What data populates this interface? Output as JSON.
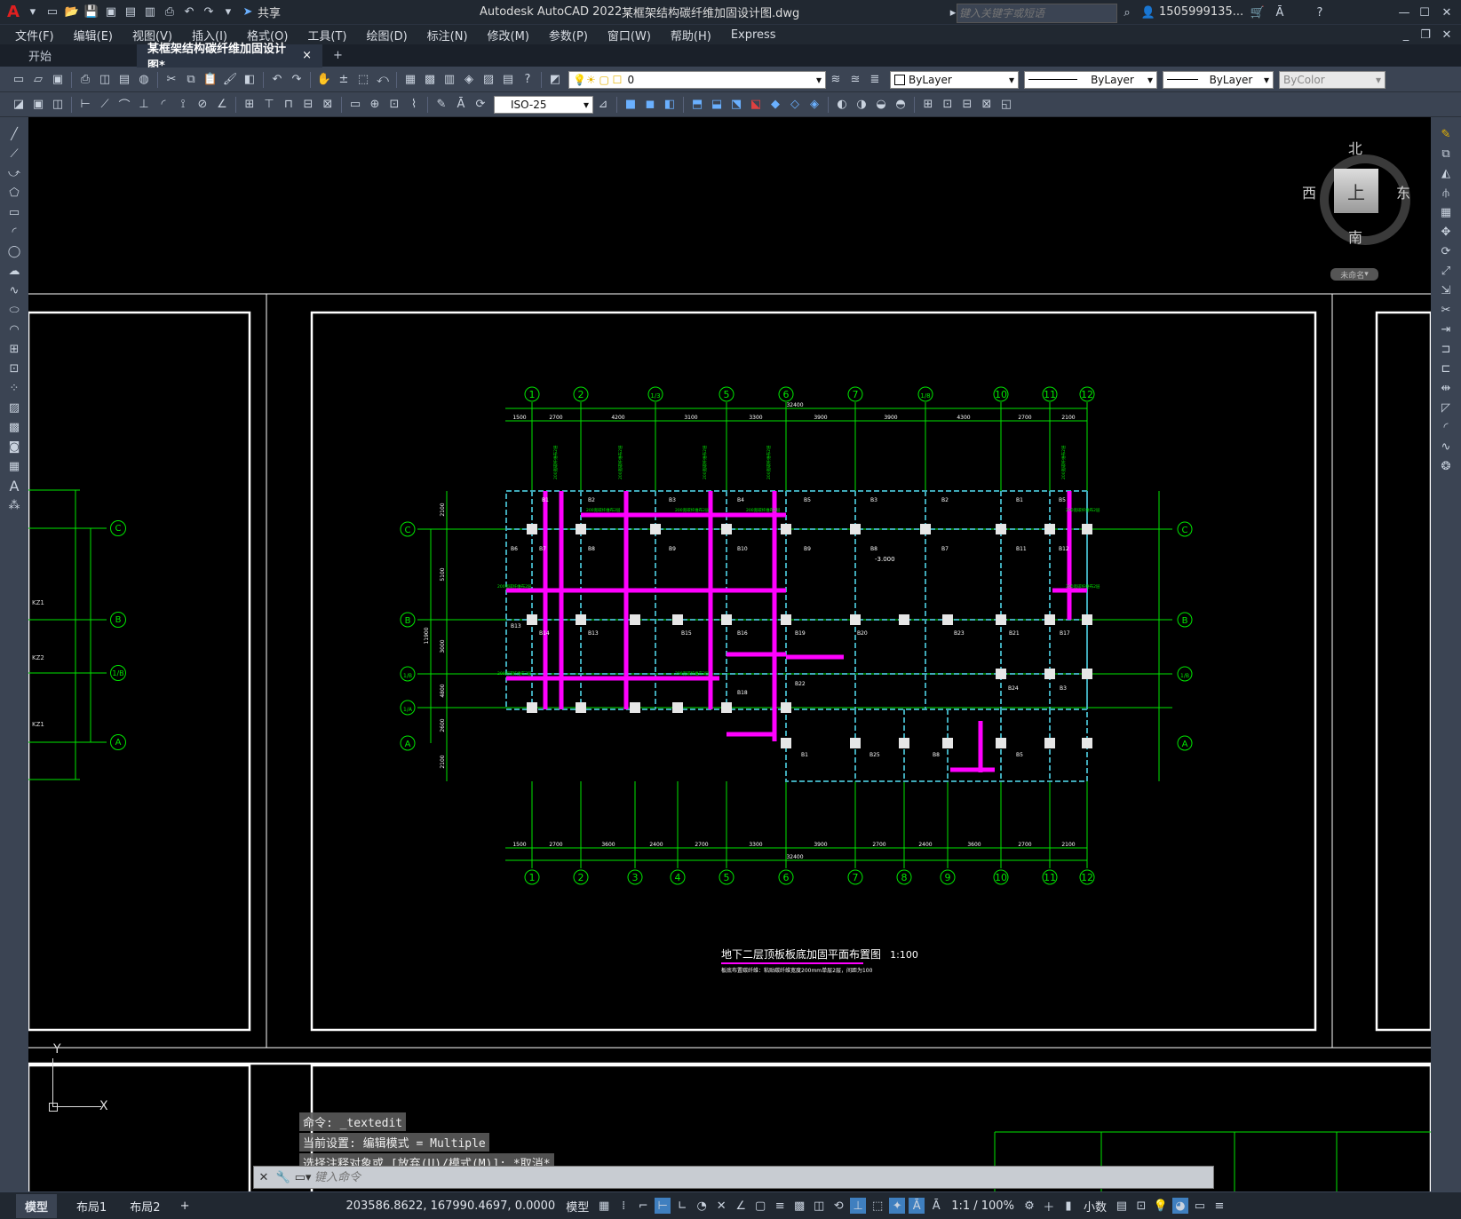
{
  "titlebar": {
    "app_title": "Autodesk AutoCAD 2022",
    "doc_title": "某框架结构碳纤维加固设计图.dwg",
    "share_label": "共享",
    "search_placeholder": "键入关键字或短语",
    "user": "1505999135...",
    "logo": "A"
  },
  "menu": [
    "文件(F)",
    "编辑(E)",
    "视图(V)",
    "插入(I)",
    "格式(O)",
    "工具(T)",
    "绘图(D)",
    "标注(N)",
    "修改(M)",
    "参数(P)",
    "窗口(W)",
    "帮助(H)",
    "Express"
  ],
  "tabs": {
    "start": "开始",
    "doc": "某框架结构碳纤维加固设计图*",
    "close": "×",
    "add": "+"
  },
  "properties": {
    "layer": "0",
    "color": "ByLayer",
    "linetype": "ByLayer",
    "lineweight": "ByLayer",
    "plotstyle": "ByColor",
    "dimstyle": "ISO-25"
  },
  "viewcube": {
    "north": "北",
    "south": "南",
    "east": "东",
    "west": "西",
    "top": "上",
    "ucs": "未命名"
  },
  "drawing": {
    "title": "地下二层顶板板底加固平面布置图",
    "scale": "1:100",
    "note": "板底布置碳纤维：粘贴碳纤维宽度200mm单层2层，间距为100",
    "elevation": "-3.000",
    "axes_top": [
      "1",
      "2",
      "1/3",
      "5",
      "6",
      "7",
      "1/8",
      "10",
      "11",
      "12"
    ],
    "axes_bottom": [
      "1",
      "2",
      "3",
      "4",
      "5",
      "6",
      "7",
      "8",
      "9",
      "10",
      "11",
      "12"
    ],
    "axes_rows": [
      "C",
      "B",
      "1/B",
      "1/A",
      "A"
    ],
    "dims_top": [
      "1500",
      "2700",
      "4200",
      "3100",
      "3300",
      "3900",
      "3900",
      "4300",
      "2700",
      "2100"
    ],
    "dims_bottom": [
      "1500",
      "2700",
      "3600",
      "2400",
      "2700",
      "3300",
      "3900",
      "2700",
      "2400",
      "3600",
      "2700",
      "2100"
    ],
    "dims_total": "32400",
    "dims_left": [
      "2100",
      "5100",
      "3000",
      "4800",
      "2600",
      "2100"
    ],
    "dims_left_total": "11900",
    "slab_labels": [
      "B1",
      "B2",
      "B3",
      "B4",
      "B5",
      "B3",
      "B2",
      "B1",
      "B5",
      "B6",
      "B7",
      "B8",
      "B9",
      "B10",
      "B9",
      "B8",
      "B7",
      "B11",
      "B12",
      "B13",
      "B14",
      "B13",
      "B15",
      "B16",
      "B19",
      "B20",
      "B23",
      "B21",
      "B17",
      "B18",
      "B22",
      "B24",
      "B3",
      "B1",
      "B25",
      "B8",
      "B5"
    ],
    "left_labels": [
      "KZ1",
      "KZ2",
      "KZ1"
    ],
    "cfrp_text": "200宽碳纤维布2层"
  },
  "ucs": {
    "x": "X",
    "y": "Y"
  },
  "command": {
    "history": [
      "命令: _textedit",
      "当前设置: 编辑模式 = Multiple",
      "选择注释对象或 [放弃(U)/模式(M)]: *取消*"
    ],
    "placeholder": "键入命令"
  },
  "layout_tabs": [
    "模型",
    "布局1",
    "布局2",
    "+"
  ],
  "status": {
    "coords": "203586.8622, 167990.4697, 0.0000",
    "mode": "模型",
    "scale": "1:1 / 100%",
    "units": "小数"
  },
  "colors": {
    "magenta": "#ff00ff",
    "green": "#00e600",
    "cyan": "#3fa9b8",
    "white": "#ffffff",
    "panel": "#3b4453"
  }
}
